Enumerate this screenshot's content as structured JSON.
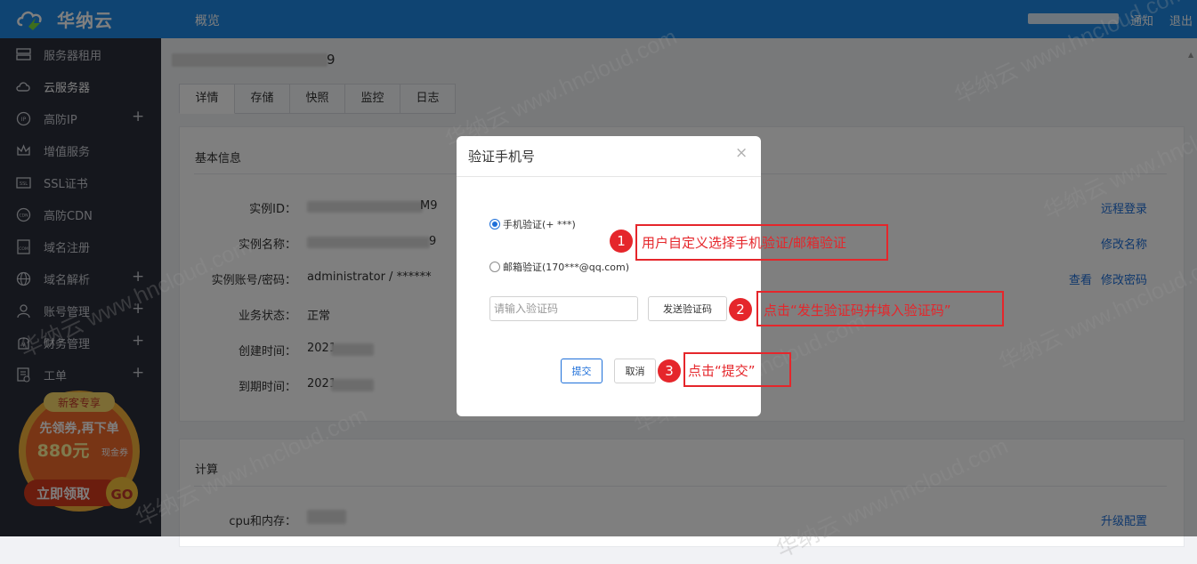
{
  "header": {
    "brand": "华纳云",
    "overview": "概览",
    "notice": "通知",
    "logout": "退出"
  },
  "sidebar": {
    "items": [
      {
        "label": "服务器租用",
        "icon": "server-icon",
        "has_plus": false
      },
      {
        "label": "云服务器",
        "icon": "cloud-icon",
        "has_plus": false
      },
      {
        "label": "高防IP",
        "icon": "ip-icon",
        "has_plus": true
      },
      {
        "label": "增值服务",
        "icon": "crown-icon",
        "has_plus": false
      },
      {
        "label": "SSL证书",
        "icon": "ssl-icon",
        "has_plus": false
      },
      {
        "label": "高防CDN",
        "icon": "cdn-icon",
        "has_plus": false
      },
      {
        "label": "域名注册",
        "icon": "com-icon",
        "has_plus": false
      },
      {
        "label": "域名解析",
        "icon": "globe-icon",
        "has_plus": true
      },
      {
        "label": "账号管理",
        "icon": "user-icon",
        "has_plus": true
      },
      {
        "label": "财务管理",
        "icon": "finance-icon",
        "has_plus": true
      },
      {
        "label": "工单",
        "icon": "ticket-icon",
        "has_plus": true
      }
    ],
    "promo": {
      "tag": "新客专享",
      "line1": "先领券,再下单",
      "amount": "880元",
      "amount_suffix": "现金券",
      "cta": "立即领取",
      "go": "GO"
    }
  },
  "page": {
    "title_suffix": "9",
    "tabs": [
      "详情",
      "存储",
      "快照",
      "监控",
      "日志"
    ],
    "basic_info": {
      "title": "基本信息",
      "rows": [
        {
          "label": "实例ID：",
          "value_tail": "M9"
        },
        {
          "label": "实例名称：",
          "value_tail": "9"
        },
        {
          "label": "实例账号/密码：",
          "value": "administrator / ******"
        },
        {
          "label": "业务状态：",
          "value": "正常"
        },
        {
          "label": "创建时间：",
          "value": "2021"
        },
        {
          "label": "到期时间：",
          "value": "2021"
        }
      ],
      "links": {
        "remote_login": "远程登录",
        "rename": "修改名称",
        "view": "查看",
        "change_password": "修改密码"
      }
    },
    "compute": {
      "title": "计算",
      "cpu_label": "cpu和内存：",
      "upgrade": "升级配置"
    }
  },
  "modal": {
    "title": "验证手机号",
    "close": "×",
    "phone_option": "手机验证(+ ***)",
    "email_option": "邮箱验证(170***@qq.com)",
    "code_placeholder": "请输入验证码",
    "send_code": "发送验证码",
    "submit": "提交",
    "cancel": "取消"
  },
  "annotations": [
    {
      "num": "1",
      "text": "用户自定义选择手机验证/邮箱验证"
    },
    {
      "num": "2",
      "text": "点击“发生验证码并填入验证码”"
    },
    {
      "num": "3",
      "text": "点击“提交”"
    }
  ],
  "watermark": {
    "text_cn": "华纳云",
    "text_en": "www.hncloud.com"
  },
  "colors": {
    "header_bg": "#1e88e5",
    "sidebar_bg": "#2b2f3a",
    "annotation_red": "#e5262b",
    "link_blue": "#1e6fd9"
  }
}
